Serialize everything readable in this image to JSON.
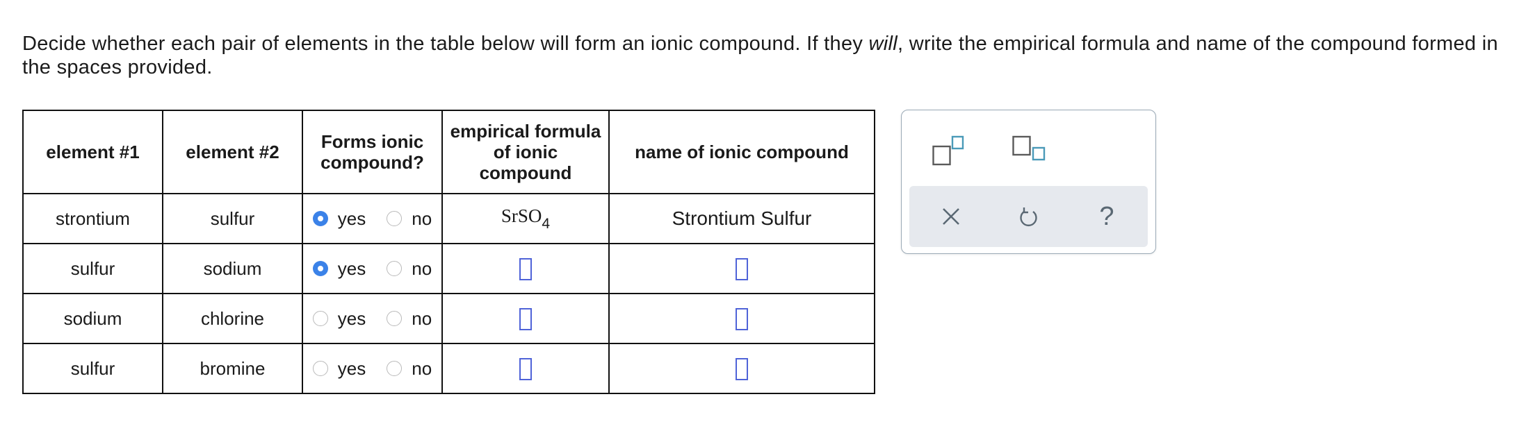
{
  "prompt": {
    "before": "Decide whether each pair of elements in the table below will form an ionic compound. If they ",
    "emphasis": "will",
    "after": ", write the empirical formula and name of the compound formed in the spaces provided."
  },
  "table": {
    "headers": [
      "element #1",
      "element #2",
      "Forms ionic compound?",
      "empirical formula of ionic compound",
      "name of ionic compound"
    ],
    "radio_labels": {
      "yes": "yes",
      "no": "no"
    },
    "rows": [
      {
        "element1": "strontium",
        "element2": "sulfur",
        "forms": "yes",
        "formula_base": "SrSO",
        "formula_sub": "4",
        "name": "Strontium Sulfur"
      },
      {
        "element1": "sulfur",
        "element2": "sodium",
        "forms": "yes",
        "formula_base": "",
        "formula_sub": "",
        "name": ""
      },
      {
        "element1": "sodium",
        "element2": "chlorine",
        "forms": "",
        "formula_base": "",
        "formula_sub": "",
        "name": ""
      },
      {
        "element1": "sulfur",
        "element2": "bromine",
        "forms": "",
        "formula_base": "",
        "formula_sub": "",
        "name": ""
      }
    ]
  },
  "toolbox": {
    "tools": [
      "superscript-template-icon",
      "subscript-template-icon"
    ],
    "actions": [
      "clear-icon",
      "undo-icon",
      "help-icon"
    ],
    "help_glyph": "?",
    "colors": {
      "accent": "#4a9ab8",
      "radio_selected": "#3b82e8",
      "answer_box": "#4f63d8",
      "panel_bar": "#e6e9ee"
    }
  }
}
